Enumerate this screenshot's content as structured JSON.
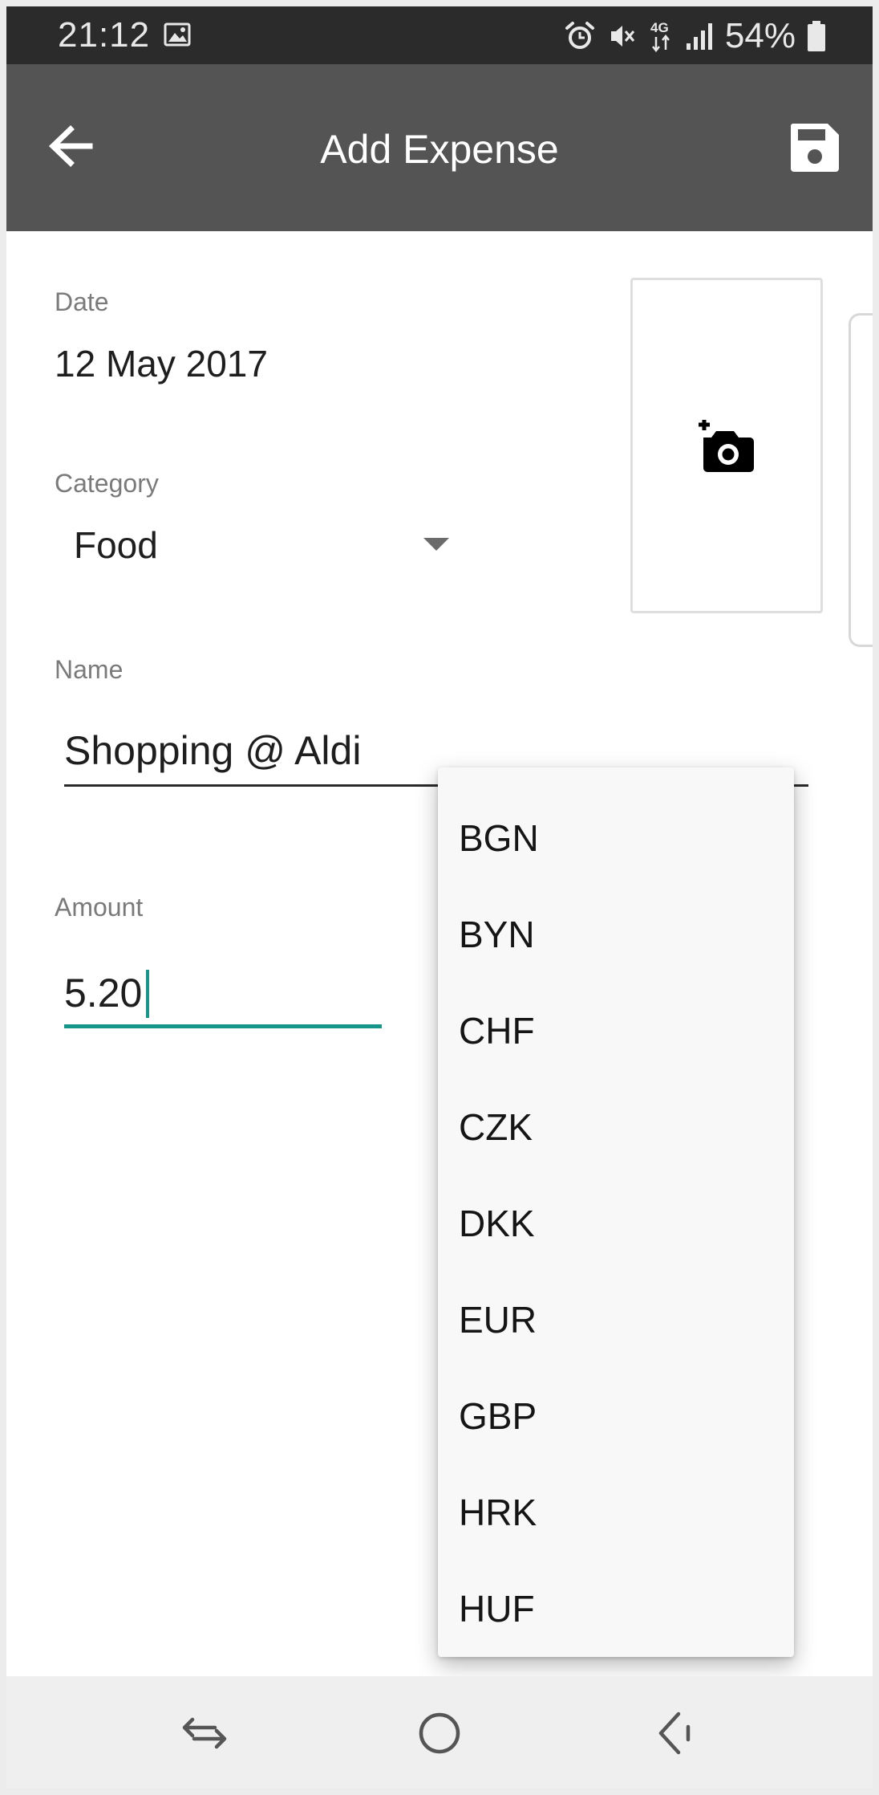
{
  "status_bar": {
    "time": "21:12",
    "battery": "54%",
    "icons": [
      "gallery-icon",
      "alarm-icon",
      "vibrate-icon",
      "4g-data-icon",
      "signal-icon",
      "battery-icon"
    ]
  },
  "app_bar": {
    "title": "Add Expense",
    "back_icon": "arrow-left-icon",
    "save_icon": "floppy-disk-icon"
  },
  "form": {
    "date_label": "Date",
    "date_value": "12 May 2017",
    "category_label": "Category",
    "category_value": "Food",
    "name_label": "Name",
    "name_value": "Shopping @ Aldi",
    "amount_label": "Amount",
    "amount_value": "5.20",
    "photo_icon": "add-a-photo-icon"
  },
  "currency_menu": {
    "options": [
      "BGN",
      "BYN",
      "CHF",
      "CZK",
      "DKK",
      "EUR",
      "GBP",
      "HRK",
      "HUF"
    ]
  },
  "nav_bar": {
    "icons": [
      "recent-apps-icon",
      "home-icon",
      "back-icon"
    ]
  },
  "colors": {
    "status_bar": "#2b2b2b",
    "app_bar": "#545454",
    "accent": "#16968a",
    "menu_background": "#f8f8f8",
    "nav_bar": "#efefef"
  }
}
